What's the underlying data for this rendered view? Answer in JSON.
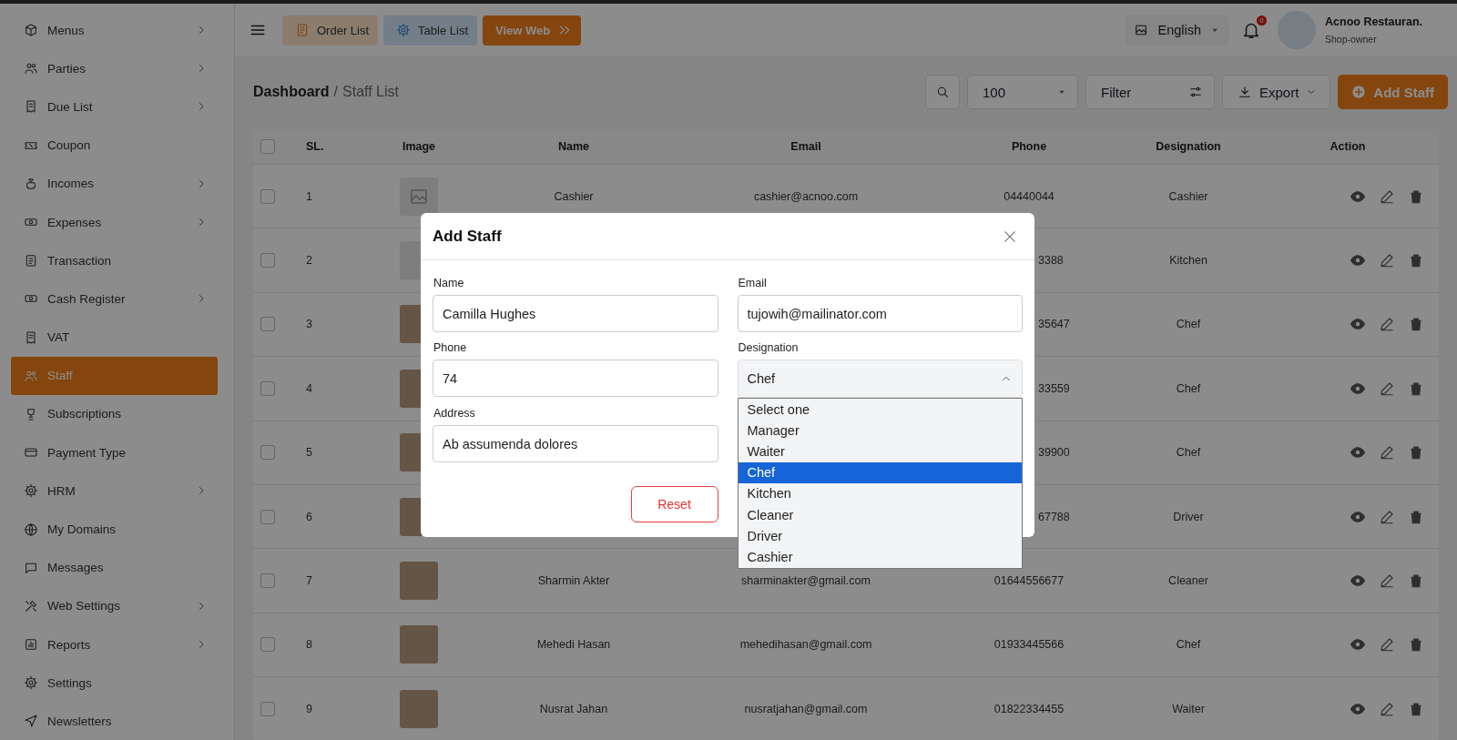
{
  "sidebar": {
    "items": [
      {
        "label": "Menus",
        "expandable": true,
        "selected": false
      },
      {
        "label": "Parties",
        "expandable": true,
        "selected": false
      },
      {
        "label": "Due List",
        "expandable": true,
        "selected": false
      },
      {
        "label": "Coupon",
        "expandable": false,
        "selected": false
      },
      {
        "label": "Incomes",
        "expandable": true,
        "selected": false
      },
      {
        "label": "Expenses",
        "expandable": true,
        "selected": false
      },
      {
        "label": "Transaction",
        "expandable": false,
        "selected": false
      },
      {
        "label": "Cash Register",
        "expandable": true,
        "selected": false
      },
      {
        "label": "VAT",
        "expandable": false,
        "selected": false
      },
      {
        "label": "Staff",
        "expandable": false,
        "selected": true
      },
      {
        "label": "Subscriptions",
        "expandable": false,
        "selected": false
      },
      {
        "label": "Payment Type",
        "expandable": false,
        "selected": false
      },
      {
        "label": "HRM",
        "expandable": true,
        "selected": false
      },
      {
        "label": "My Domains",
        "expandable": false,
        "selected": false
      },
      {
        "label": "Messages",
        "expandable": false,
        "selected": false
      },
      {
        "label": "Web Settings",
        "expandable": true,
        "selected": false
      },
      {
        "label": "Reports",
        "expandable": true,
        "selected": false
      },
      {
        "label": "Settings",
        "expandable": false,
        "selected": false
      },
      {
        "label": "Newsletters",
        "expandable": false,
        "selected": false
      }
    ]
  },
  "header": {
    "buttons": [
      {
        "label": "Order List",
        "kind": "order"
      },
      {
        "label": "Table List",
        "kind": "table"
      },
      {
        "label": "View Web",
        "kind": "web"
      }
    ],
    "language": "English",
    "notification_count": "0",
    "user": {
      "name": "Acnoo Restauran.",
      "role": "Shop-owner"
    }
  },
  "breadcrumb": {
    "root": "Dashboard",
    "separator": "/",
    "current": "Staff List"
  },
  "toolbar": {
    "page_size": "100",
    "filter": "Filter",
    "export": "Export",
    "add": "Add Staff"
  },
  "table": {
    "all_checked": false,
    "columns": [
      "SL.",
      "Image",
      "Name",
      "Email",
      "Phone",
      "Designation",
      "Action"
    ],
    "rows": [
      {
        "checked": false,
        "sl": "1",
        "image": {
          "kind": "placeholder"
        },
        "name": "Cashier",
        "email": "cashier@acnoo.com",
        "phone": "04440044",
        "designation": "Cashier",
        "covered": false
      },
      {
        "checked": false,
        "sl": "2",
        "image": {
          "kind": "placeholder"
        },
        "phone": "3388",
        "designation": "Kitchen",
        "covered": true
      },
      {
        "checked": false,
        "sl": "3",
        "image": {
          "kind": "photo"
        },
        "phone": "35647",
        "designation": "Chef",
        "covered": true
      },
      {
        "checked": false,
        "sl": "4",
        "image": {
          "kind": "photo"
        },
        "phone": "33559",
        "designation": "Chef",
        "covered": true
      },
      {
        "checked": false,
        "sl": "5",
        "image": {
          "kind": "photo"
        },
        "phone": "39900",
        "designation": "Chef",
        "covered": true
      },
      {
        "checked": false,
        "sl": "6",
        "image": {
          "kind": "photo"
        },
        "phone": "67788",
        "designation": "Driver",
        "covered": true
      },
      {
        "checked": false,
        "sl": "7",
        "image": {
          "kind": "photo"
        },
        "name": "Sharmin Akter",
        "email": "sharminakter@gmail.com",
        "phone": "01644556677",
        "designation": "Cleaner",
        "covered": false
      },
      {
        "checked": false,
        "sl": "8",
        "image": {
          "kind": "photo"
        },
        "name": "Mehedi Hasan",
        "email": "mehedihasan@gmail.com",
        "phone": "01933445566",
        "designation": "Chef",
        "covered": false
      },
      {
        "checked": false,
        "sl": "9",
        "image": {
          "kind": "photo"
        },
        "name": "Nusrat Jahan",
        "email": "nusratjahan@gmail.com",
        "phone": "01822334455",
        "designation": "Waiter",
        "covered": false
      }
    ]
  },
  "modal": {
    "title": "Add Staff",
    "fields": [
      {
        "label": "Name",
        "value": "Camilla Hughes",
        "kind": "text"
      },
      {
        "label": "Email",
        "value": "tujowih@mailinator.com",
        "kind": "text"
      },
      {
        "label": "Phone",
        "value": "74",
        "kind": "text"
      },
      {
        "label": "Designation",
        "value": "Chef",
        "kind": "select",
        "expanded": true,
        "options": [
          {
            "label": "Select one",
            "selected": false
          },
          {
            "label": "Manager",
            "selected": false
          },
          {
            "label": "Waiter",
            "selected": false
          },
          {
            "label": "Chef",
            "selected": true
          },
          {
            "label": "Kitchen",
            "selected": false
          },
          {
            "label": "Cleaner",
            "selected": false
          },
          {
            "label": "Driver",
            "selected": false
          },
          {
            "label": "Cashier",
            "selected": false
          }
        ]
      },
      {
        "label": "Address",
        "value": "Ab assumenda dolores",
        "kind": "text"
      }
    ],
    "buttons": [
      {
        "label": "Reset",
        "kind": "reset"
      }
    ]
  }
}
